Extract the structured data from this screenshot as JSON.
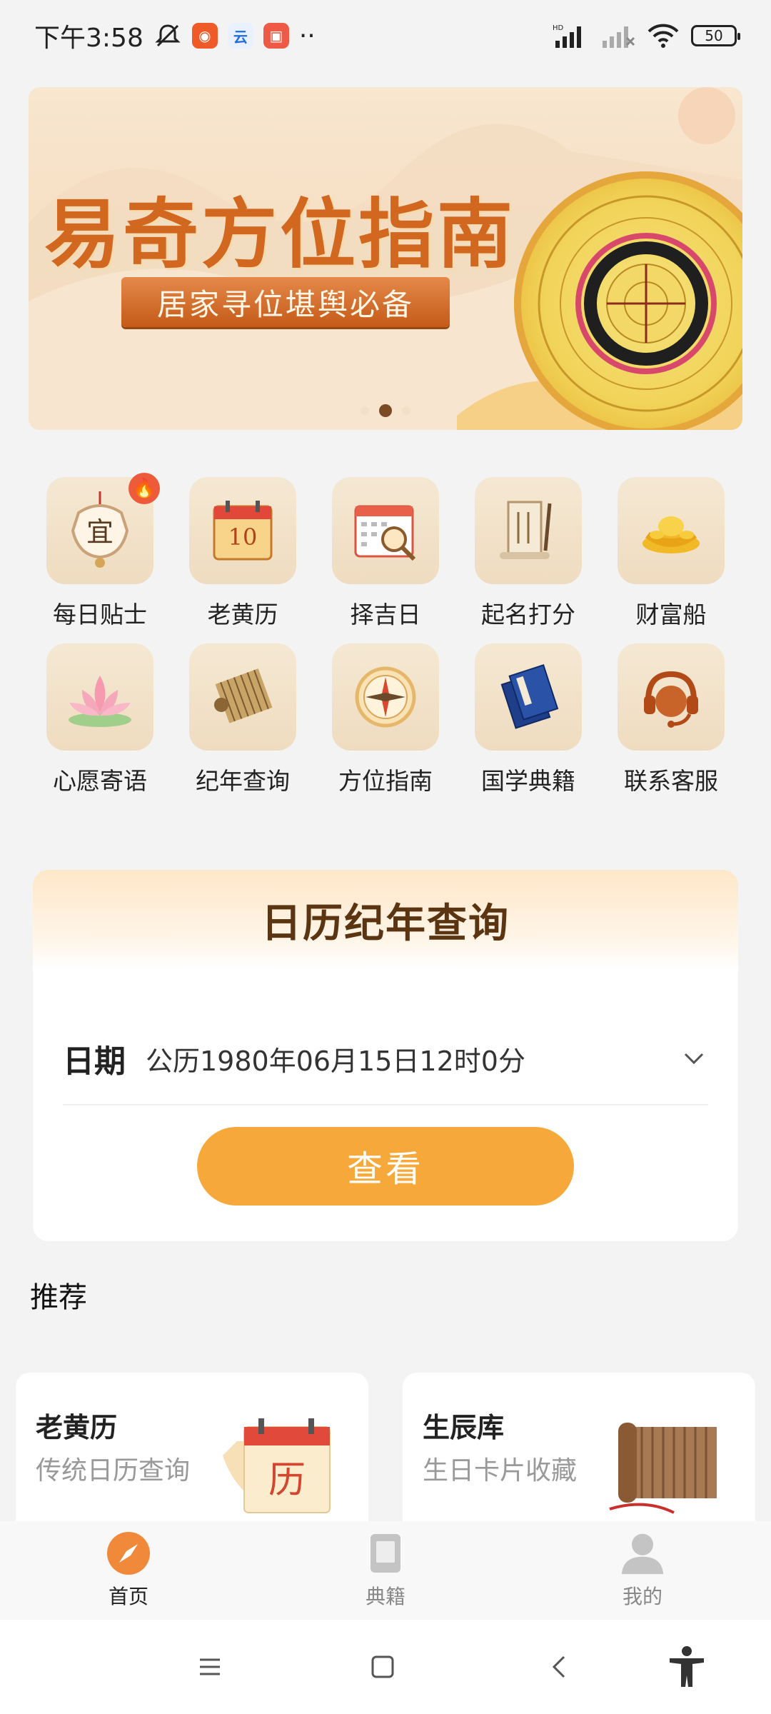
{
  "status_bar": {
    "time": "下午3:58",
    "battery": "50",
    "signal_label": "HD"
  },
  "banner": {
    "title": "易奇方位指南",
    "subtitle": "居家寻位堪舆必备",
    "pages": 3,
    "active_page": 2
  },
  "features": [
    {
      "label": "每日贴士",
      "icon": "yi-lantern-icon",
      "glyph": "宜",
      "hot": true
    },
    {
      "label": "老黄历",
      "icon": "calendar-icon",
      "glyph": "10"
    },
    {
      "label": "择吉日",
      "icon": "calendar-magnifier-icon",
      "glyph": "🔍"
    },
    {
      "label": "起名打分",
      "icon": "scroll-brush-icon",
      "glyph": "📜"
    },
    {
      "label": "财富船",
      "icon": "gold-ingot-icon",
      "glyph": "💰"
    },
    {
      "label": "心愿寄语",
      "icon": "lotus-icon",
      "glyph": "🪷"
    },
    {
      "label": "纪年查询",
      "icon": "bamboo-scroll-icon",
      "glyph": "📃"
    },
    {
      "label": "方位指南",
      "icon": "compass-icon",
      "glyph": "🧭"
    },
    {
      "label": "国学典籍",
      "icon": "books-icon",
      "glyph": "📘"
    },
    {
      "label": "联系客服",
      "icon": "headset-icon",
      "glyph": "🎧"
    }
  ],
  "calendar_card": {
    "title": "日历纪年查询",
    "date_label": "日期",
    "date_value": "公历1980年06月15日12时0分",
    "button_label": "查看"
  },
  "recommend": {
    "section_title": "推荐",
    "items": [
      {
        "title": "老黄历",
        "subtitle": "传统日历查询",
        "image": "calendar-li-icon",
        "image_text": "历"
      },
      {
        "title": "生辰库",
        "subtitle": "生日卡片收藏",
        "image": "scroll-icon"
      }
    ]
  },
  "tab_bar": {
    "tabs": [
      {
        "label": "首页",
        "icon": "home-compass-icon",
        "active": true
      },
      {
        "label": "典籍",
        "icon": "book-icon",
        "active": false
      },
      {
        "label": "我的",
        "icon": "user-icon",
        "active": false
      }
    ]
  },
  "colors": {
    "accent": "#f6a93a",
    "banner_title": "#d2671f",
    "card_title": "#5b3512",
    "tab_active": "#f08a3a"
  }
}
